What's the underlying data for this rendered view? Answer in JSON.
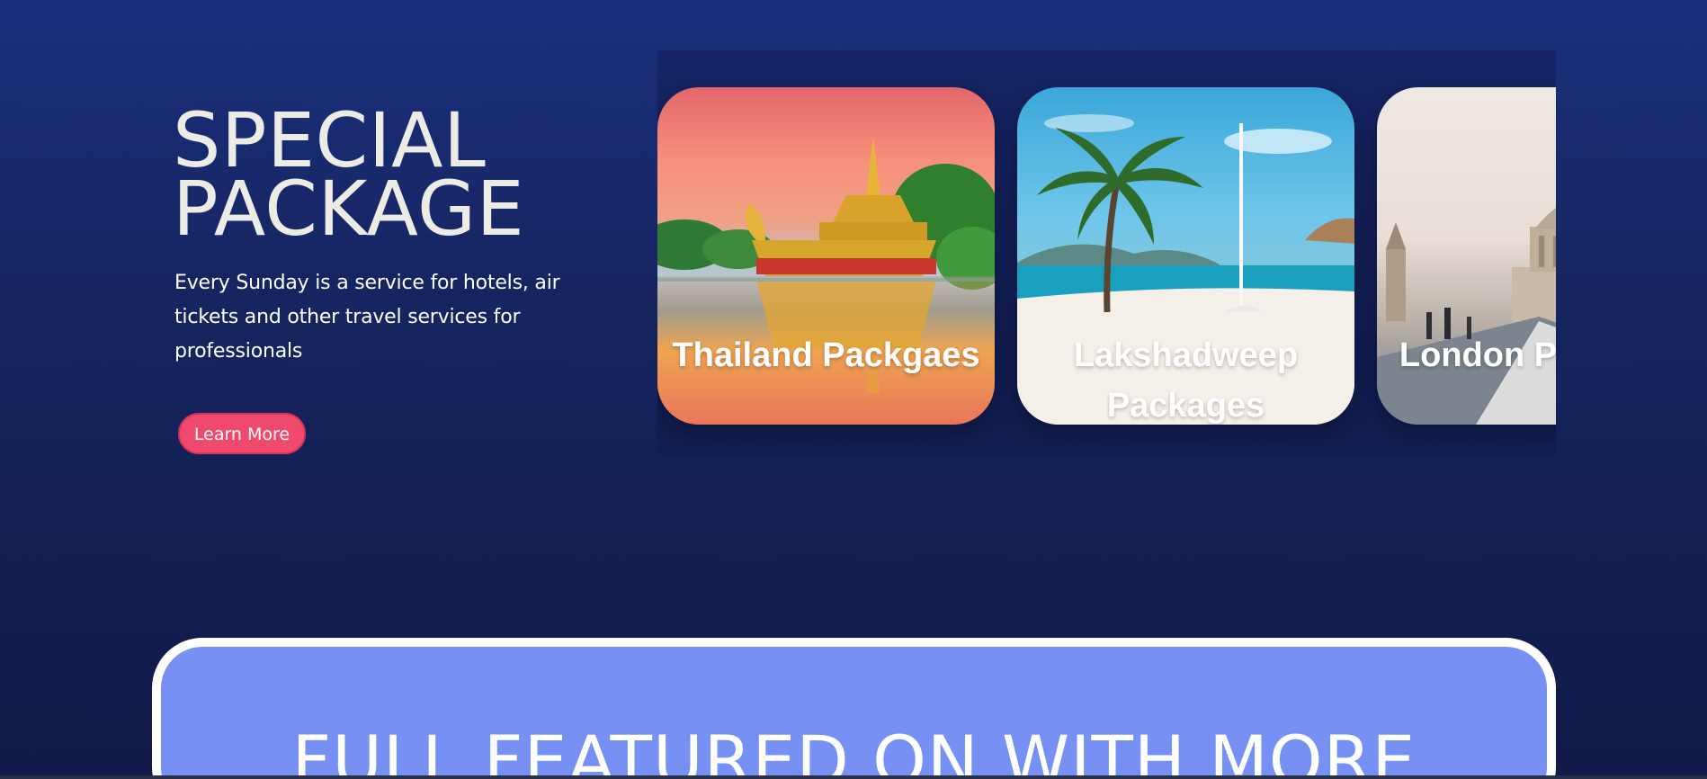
{
  "hero": {
    "title_line1": "SPECIAL",
    "title_line2": "PACKAGE",
    "description": "Every Sunday is a service for hotels, air tickets and other travel services for professionals",
    "button_label": "Learn More"
  },
  "packages": [
    {
      "label": "Thailand Packgaes",
      "image": "golden-pagoda-lake-sunset"
    },
    {
      "label": "Lakshadweep Packages",
      "image": "tropical-beach-palm"
    },
    {
      "label": "London Packages",
      "image": "st-pauls-millennium-bridge"
    }
  ],
  "feature": {
    "title": "FULL FEATURED ON WITH MORE"
  },
  "colors": {
    "background_top": "#1b2f7d",
    "background_bottom": "#111a48",
    "button": "#f0496e",
    "feature_panel": "#7790f4",
    "title_text": "#ecebe4"
  }
}
